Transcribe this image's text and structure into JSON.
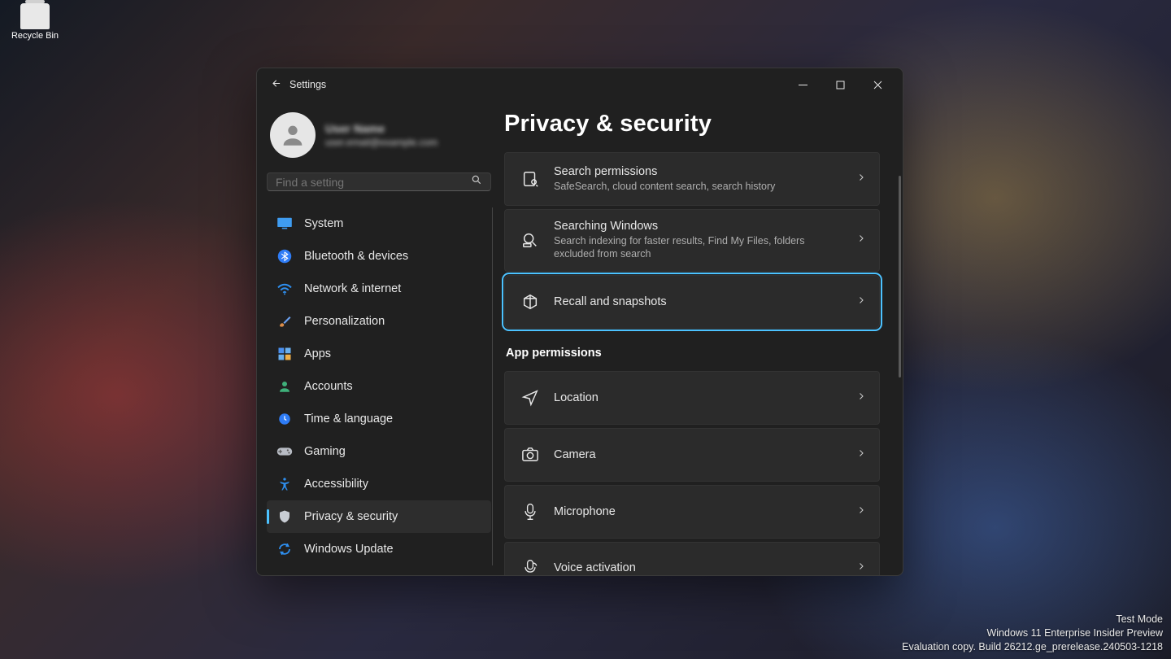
{
  "desktop": {
    "recycle_bin": "Recycle Bin"
  },
  "watermark": {
    "line1": "Test Mode",
    "line2": "Windows 11 Enterprise Insider Preview",
    "line3": "Evaluation copy. Build 26212.ge_prerelease.240503-1218"
  },
  "window": {
    "title": "Settings",
    "profile": {
      "name": "User Name",
      "email": "user.email@example.com"
    },
    "search_placeholder": "Find a setting",
    "nav": [
      {
        "label": "System",
        "icon": "display-icon"
      },
      {
        "label": "Bluetooth & devices",
        "icon": "bluetooth-icon"
      },
      {
        "label": "Network & internet",
        "icon": "wifi-icon"
      },
      {
        "label": "Personalization",
        "icon": "brush-icon"
      },
      {
        "label": "Apps",
        "icon": "apps-icon"
      },
      {
        "label": "Accounts",
        "icon": "person-icon"
      },
      {
        "label": "Time & language",
        "icon": "clock-icon"
      },
      {
        "label": "Gaming",
        "icon": "gamepad-icon"
      },
      {
        "label": "Accessibility",
        "icon": "accessibility-icon"
      },
      {
        "label": "Privacy & security",
        "icon": "shield-icon",
        "active": true
      },
      {
        "label": "Windows Update",
        "icon": "update-icon"
      }
    ],
    "page_title": "Privacy & security",
    "groups": [
      {
        "items": [
          {
            "title": "Search permissions",
            "subtitle": "SafeSearch, cloud content search, search history",
            "icon": "search-page-icon"
          },
          {
            "title": "Searching Windows",
            "subtitle": "Search indexing for faster results, Find My Files, folders excluded from search",
            "icon": "search-index-icon"
          },
          {
            "title": "Recall and snapshots",
            "icon": "recall-icon",
            "focused": true
          }
        ]
      },
      {
        "label": "App permissions",
        "items": [
          {
            "title": "Location",
            "icon": "location-icon"
          },
          {
            "title": "Camera",
            "icon": "camera-icon"
          },
          {
            "title": "Microphone",
            "icon": "microphone-icon"
          },
          {
            "title": "Voice activation",
            "icon": "voice-icon",
            "cut": true
          }
        ]
      }
    ]
  }
}
